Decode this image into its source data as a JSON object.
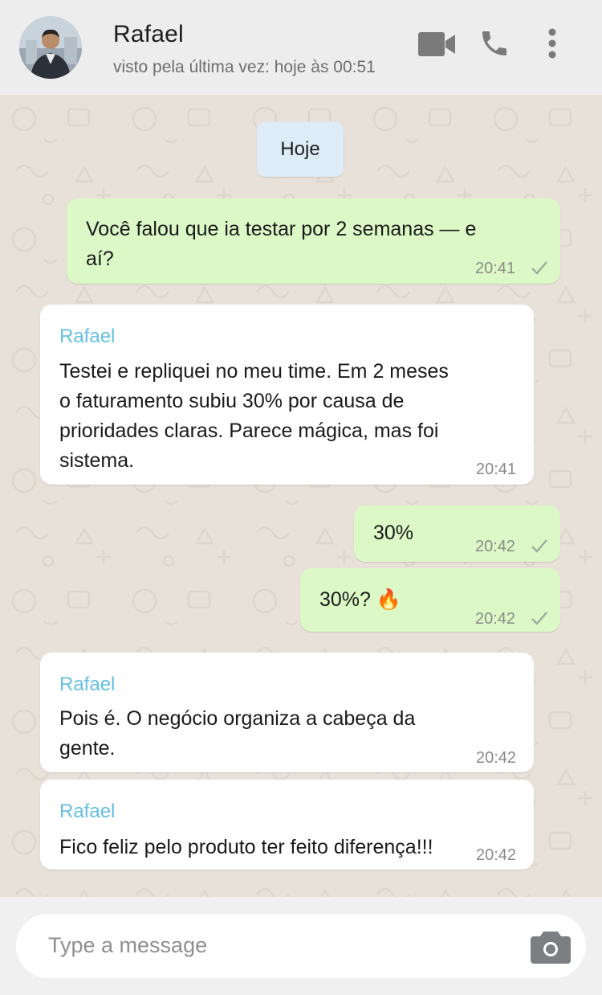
{
  "contact": {
    "name": "Rafael",
    "status": "visto pela última vez: hoje às 00:51"
  },
  "header_icons": [
    "video-call-icon",
    "phone-call-icon",
    "more-options-icon"
  ],
  "date_chip": "Hoje",
  "messages": [
    {
      "direction": "outgoing",
      "lines": [
        "Você falou que ia testar por 2 semanas — e",
        "aí?"
      ],
      "time": "20:41",
      "ticks": "single-check"
    },
    {
      "direction": "incoming",
      "sender": "Rafael",
      "lines": [
        "Testei e repliquei no meu time. Em 2 meses",
        "o faturamento subiu 30% por causa de",
        "prioridades claras. Parece mágica, mas foi",
        "sistema."
      ],
      "time": "20:41"
    },
    {
      "direction": "outgoing",
      "lines": [
        "30%"
      ],
      "time": "20:42",
      "ticks": "single-check"
    },
    {
      "direction": "outgoing",
      "lines": [
        "30%? 🔥"
      ],
      "time": "20:42",
      "ticks": "single-check"
    },
    {
      "direction": "incoming",
      "sender": "Rafael",
      "lines": [
        "Pois é. O negócio organiza a cabeça da",
        "gente."
      ],
      "time": "20:42"
    },
    {
      "direction": "incoming",
      "sender": "Rafael",
      "lines": [
        "Fico feliz pelo produto ter feito diferença!!!"
      ],
      "time": "20:42"
    }
  ],
  "composer": {
    "placeholder": "Type a message",
    "icon": "camera-icon"
  },
  "colors": {
    "outgoing_bubble": "#dcf8c6",
    "incoming_bubble": "#ffffff",
    "sender_name": "#64c0e2",
    "date_chip": "#ddecf6",
    "chat_background": "#e7e1d9"
  }
}
